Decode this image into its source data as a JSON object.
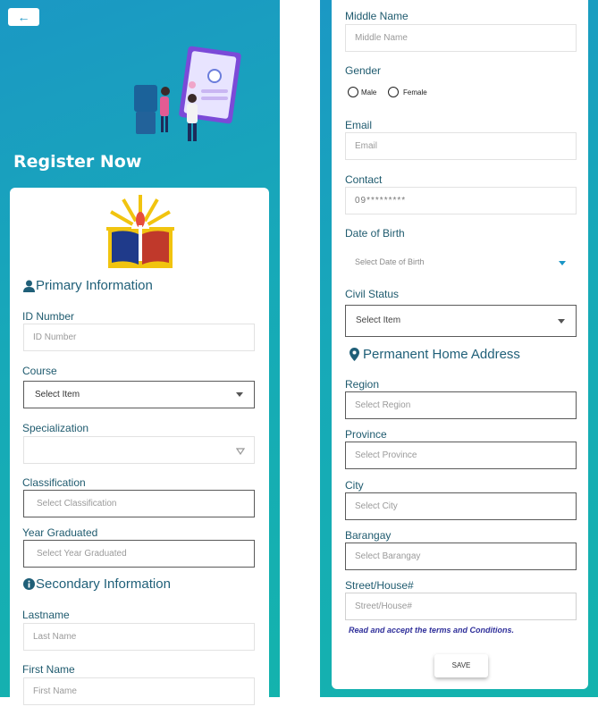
{
  "header": {
    "back_icon": "arrow-left-icon",
    "title": "Register Now"
  },
  "primary": {
    "section_title": "Primary Information",
    "id_number": {
      "label": "ID Number",
      "placeholder": "ID Number"
    },
    "course": {
      "label": "Course",
      "value": "Select Item"
    },
    "specialization": {
      "label": "Specialization",
      "value": ""
    },
    "classification": {
      "label": "Classification",
      "placeholder": "Select  Classification"
    },
    "year_graduated": {
      "label": "Year Graduated",
      "placeholder": "Select  Year Graduated"
    }
  },
  "secondary": {
    "section_title": "Secondary Information",
    "lastname": {
      "label": "Lastname",
      "placeholder": "Last Name"
    },
    "first_name": {
      "label": "First Name",
      "placeholder": "First Name"
    },
    "middle_name": {
      "label": "Middle Name",
      "placeholder": "Middle Name"
    },
    "gender": {
      "label": "Gender",
      "options": [
        "Male",
        "Female"
      ]
    },
    "email": {
      "label": "Email",
      "placeholder": "Email"
    },
    "contact": {
      "label": "Contact",
      "placeholder": "09*********"
    },
    "dob": {
      "label": "Date of Birth",
      "placeholder": "Select Date of Birth"
    },
    "civil_status": {
      "label": "Civil Status",
      "value": "Select Item"
    }
  },
  "address": {
    "section_title": "Permanent Home Address",
    "region": {
      "label": "Region",
      "placeholder": "Select Region"
    },
    "province": {
      "label": "Province",
      "placeholder": "Select Province"
    },
    "city": {
      "label": "City",
      "placeholder": "Select City"
    },
    "barangay": {
      "label": "Barangay",
      "placeholder": "Select Barangay"
    },
    "street": {
      "label": "Street/House#",
      "placeholder": "Street/House#"
    }
  },
  "terms_text": "Read and accept the terms and Conditions.",
  "save_label": "SAVE",
  "colors": {
    "gradient_start": "#1b98c4",
    "gradient_end": "#14b3ad",
    "label_text": "#1e5a6e",
    "terms_text": "#2f2f9a"
  }
}
